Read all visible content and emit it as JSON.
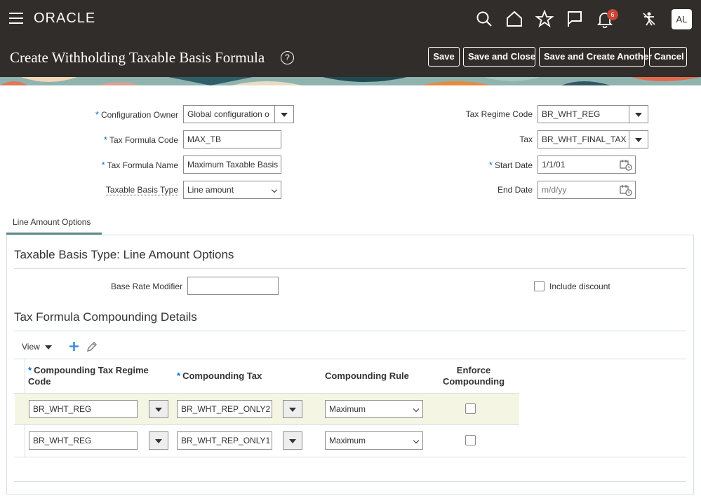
{
  "header": {
    "brand": "ORACLE",
    "notification_count": "6",
    "user_initials": "AL",
    "icons": [
      "search-icon",
      "home-icon",
      "star-icon",
      "flag-icon",
      "bell-icon",
      "accessibility-icon"
    ]
  },
  "titlebar": {
    "title": "Create Withholding Taxable Basis Formula",
    "help": "?",
    "save_label": "Save",
    "save_close_label": "Save and Close",
    "save_create_another_label": "Save and Create Another",
    "cancel_label": "Cancel"
  },
  "form": {
    "configuration_owner": {
      "label": "Configuration Owner",
      "value": "Global configuration o"
    },
    "tax_formula_code": {
      "label": "Tax Formula Code",
      "value": "MAX_TB"
    },
    "tax_formula_name": {
      "label": "Tax Formula Name",
      "value": "Maximum Taxable Basis"
    },
    "taxable_basis_type": {
      "label": "Taxable Basis Type",
      "value": "Line amount"
    },
    "tax_regime_code": {
      "label": "Tax Regime Code",
      "value": "BR_WHT_REG"
    },
    "tax": {
      "label": "Tax",
      "value": "BR_WHT_FINAL_TAX"
    },
    "start_date": {
      "label": "Start Date",
      "value": "1/1/01"
    },
    "end_date": {
      "label": "End Date",
      "placeholder": "m/d/yy"
    }
  },
  "tabs": [
    {
      "label": "Line Amount Options"
    }
  ],
  "line_amount_options": {
    "section_title": "Taxable Basis Type: Line Amount Options",
    "base_rate_modifier_label": "Base Rate Modifier",
    "base_rate_modifier_value": "",
    "include_discount_label": "Include discount"
  },
  "compounding": {
    "section_title": "Tax Formula Compounding Details",
    "view_label": "View",
    "columns": {
      "regime_code_line1": "Compounding Tax Regime",
      "regime_code_line2": "Code",
      "tax": "Compounding Tax",
      "rule": "Compounding Rule",
      "enforce_line1": "Enforce",
      "enforce_line2": "Compounding"
    },
    "rows": [
      {
        "regime_code": "BR_WHT_REG",
        "tax": "BR_WHT_REP_ONLY2",
        "rule": "Maximum",
        "enforce": false
      },
      {
        "regime_code": "BR_WHT_REG",
        "tax": "BR_WHT_REP_ONLY1",
        "rule": "Maximum",
        "enforce": false
      }
    ]
  },
  "colors": {
    "header_bg": "#312d2a",
    "required_marker": "#0572ce",
    "badge": "#c74634",
    "tab_underline": "#5c8a8a",
    "selected_row": "#f4f6e3"
  }
}
